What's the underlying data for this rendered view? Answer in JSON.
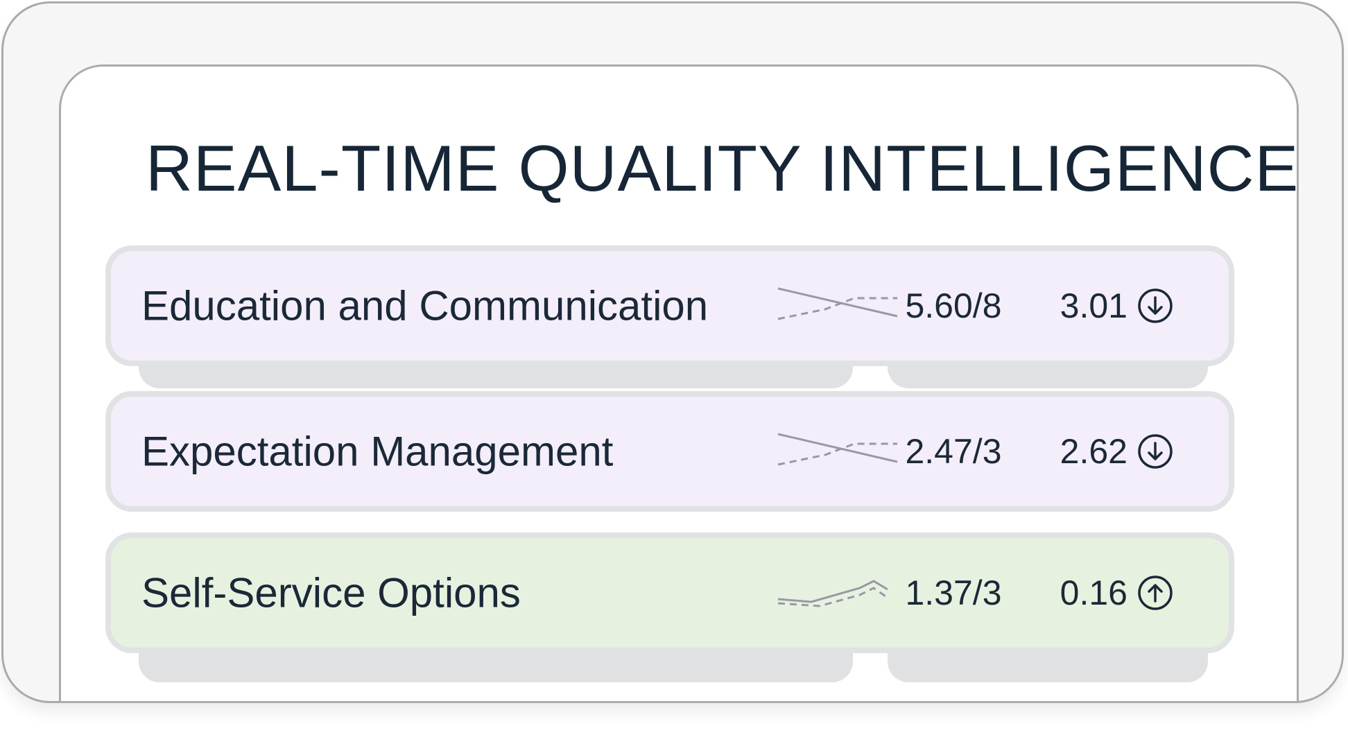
{
  "title": "REAL-TIME QUALITY INTELLIGENCE",
  "metrics": [
    {
      "label": "Education and Communication",
      "score": "5.60/8",
      "delta": "3.01",
      "trend_icon": "arrow-down-circle-icon",
      "row_color": "#f3eef9"
    },
    {
      "label": "Expectation Management",
      "score": "2.47/3",
      "delta": "2.62",
      "trend_icon": "arrow-down-circle-icon",
      "row_color": "#f3eef9"
    },
    {
      "label": "Self-Service Options",
      "score": "1.37/3",
      "delta": "0.16",
      "trend_icon": "arrow-up-circle-icon",
      "row_color": "#e6f2df"
    }
  ],
  "colors": {
    "text": "#1b2838",
    "sparkline": "#9a98a4",
    "border": "#e0e2e4"
  }
}
